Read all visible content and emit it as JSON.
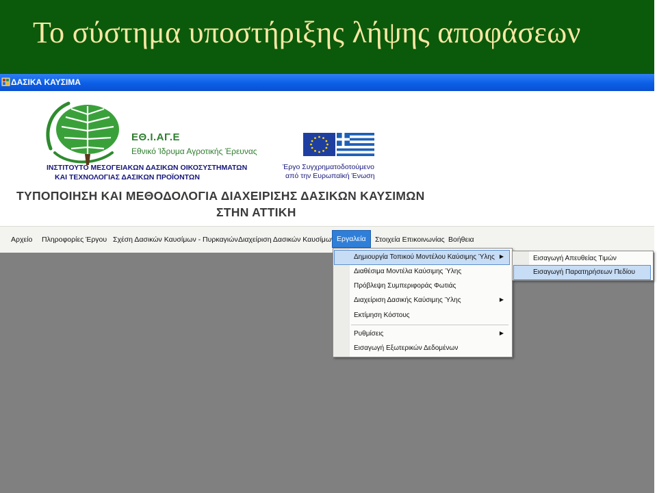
{
  "slide": {
    "title": "Το σύστημα υποστήριξης λήψης αποφάσεων"
  },
  "window": {
    "title": "ΔΑΣΙΚΑ ΚΑΥΣΙΜΑ",
    "icon": "app-icon"
  },
  "banner": {
    "org_acronym": "ΕΘ.Ι.ΑΓ.Ε",
    "org_name": "Εθνικό Ίδρυμα Αγροτικής Έρευνας",
    "institute_line1": "ΙΝΣΤΙΤΟΥΤΟ ΜΕΣΟΓΕΙΑΚΩΝ ΔΑΣΙΚΩΝ ΟΙΚΟΣΥΣΤΗΜΑΤΩΝ",
    "institute_line2": "ΚΑΙ ΤΕΧΝΟΛΟΓΙΑΣ ΔΑΣΙΚΩΝ ΠΡΟΪΟΝΤΩΝ",
    "eu_line1": "Έργο Συγχρηματοδοτούμενο",
    "eu_line2": "από την Ευρωπαϊκή Ένωση",
    "project_title_line1": "ΤΥΠΟΠΟΙΗΣΗ ΚΑΙ ΜΕΘΟΔΟΛΟΓΙΑ ΔΙΑΧΕΙΡΙΣΗΣ ΔΑΣΙΚΩΝ ΚΑΥΣΙΜΩΝ",
    "project_title_line2": "ΣΤΗΝ ΑΤΤΙΚΗ"
  },
  "menubar": {
    "items": [
      {
        "label": "Αρχείο"
      },
      {
        "label": "Πληροφορίες Έργου"
      },
      {
        "label": "Σχέση Δασικών Καυσίμων - Πυρκαγιών"
      },
      {
        "label": "Διαχείριση Δασικών Καυσίμων"
      },
      {
        "label": "Εργαλεία"
      },
      {
        "label": "Στοιχεία Επικοινωνίας"
      },
      {
        "label": "Βοήθεια"
      }
    ],
    "active": "Εργαλεία"
  },
  "tools_menu": {
    "items": [
      {
        "label": "Δημιουργία Τοπικού Μοντέλου Καύσιμης Ύλης",
        "submenu": true
      },
      {
        "label": "Διαθέσιμα Μοντέλα Καύσιμης Ύλης"
      },
      {
        "label": "Πρόβλεψη Συμπεριφοράς Φωτιάς"
      },
      {
        "label": "Διαχείριση Δασικής Καύσιμης Ύλης",
        "submenu": true
      },
      {
        "label": "Εκτίμηση Κόστους"
      },
      {
        "label": "Ρυθμίσεις",
        "submenu": true
      },
      {
        "label": "Εισαγωγή Εξωτερικών Δεδομένων"
      }
    ],
    "arrow": "▶"
  },
  "submenu": {
    "items": [
      {
        "label": "Εισαγωγή Απευθείας Τιμών"
      },
      {
        "label": "Εισαγωγή Παρατηρήσεων Πεδίου"
      }
    ]
  },
  "colors": {
    "slide_header_bg": "#0b5a0b",
    "slide_title": "#f7e7a3",
    "workspace": "#808080",
    "menu_active": "#2f7fd8",
    "menu_highlight": "#c7dcf5"
  }
}
